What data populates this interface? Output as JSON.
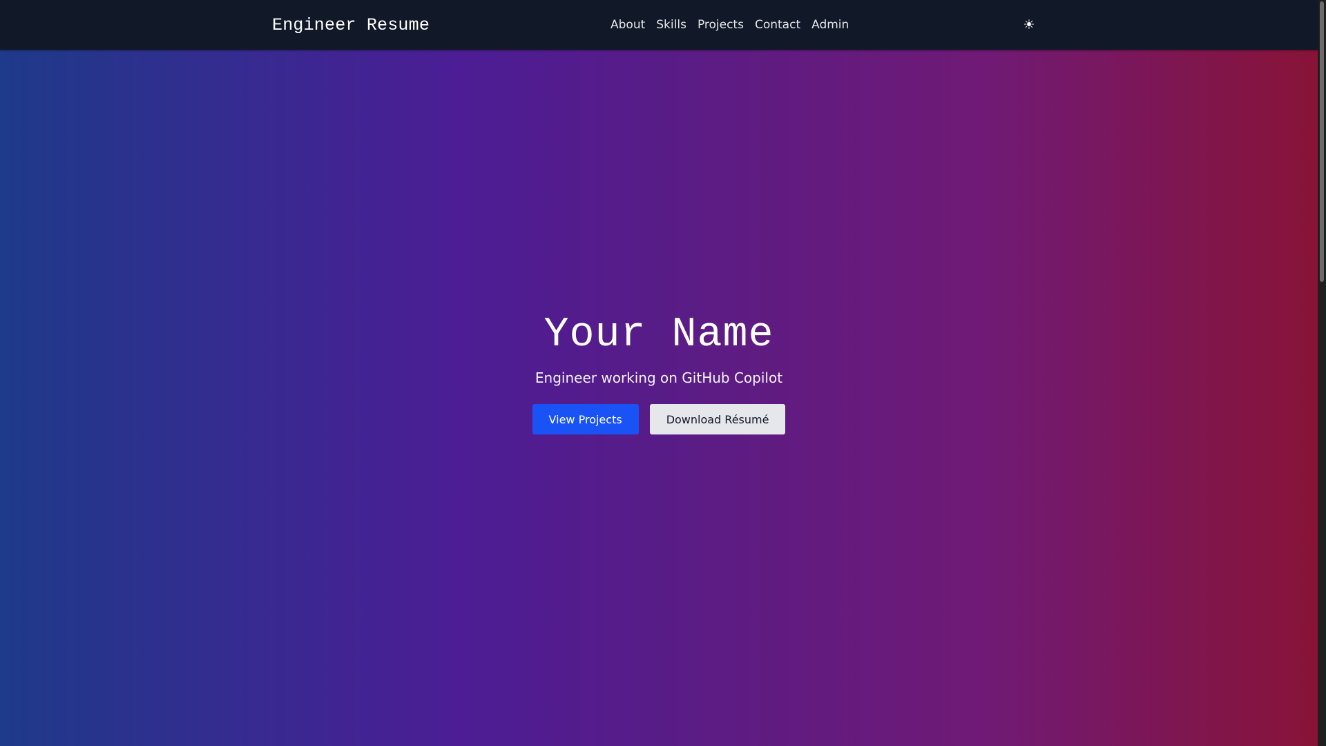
{
  "header": {
    "brand": "Engineer Resume",
    "nav": [
      {
        "label": "About"
      },
      {
        "label": "Skills"
      },
      {
        "label": "Projects"
      },
      {
        "label": "Contact"
      },
      {
        "label": "Admin"
      }
    ],
    "theme_toggle_glyph": "☀",
    "theme_toggle_icon": "sun-icon"
  },
  "hero": {
    "title": "Your Name",
    "subtitle": "Engineer working on GitHub Copilot",
    "primary_button": "View Projects",
    "secondary_button": "Download Résumé"
  },
  "colors": {
    "navbar_bg": "#111827",
    "gradient_start": "#1e3a8a",
    "gradient_mid": "#581c87",
    "gradient_end": "#881337",
    "primary_button_bg": "#1a53f5",
    "secondary_button_bg": "#e5e7eb"
  }
}
